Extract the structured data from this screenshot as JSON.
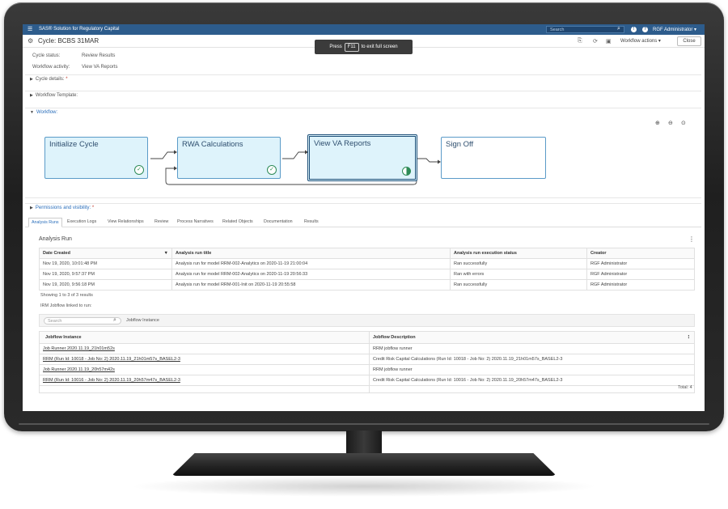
{
  "app": {
    "title": "SAS® Solution for Regulatory Capital",
    "search_placeholder": "Search",
    "user": "RGF Administrator ▾"
  },
  "header": {
    "cycle_title": "Cycle: BCBS 31MAR",
    "workflow_actions": "Workflow actions ▾",
    "close": "Close"
  },
  "toast": {
    "press": "Press",
    "key": "F11",
    "rest": "to exit full screen"
  },
  "info": {
    "cycle_status_label": "Cycle status:",
    "cycle_status_value": "Review Results",
    "workflow_activity_label": "Workflow activity:",
    "workflow_activity_value": "View VA Reports"
  },
  "sections": {
    "cycle_details": "Cycle details:",
    "workflow_template": "Workflow Template:",
    "workflow": "Workflow:",
    "permissions": "Permissions and visibility:",
    "required_mark": "*"
  },
  "workflow_nodes": [
    {
      "label": "Initialize Cycle",
      "status": "complete"
    },
    {
      "label": "RWA Calculations",
      "status": "complete"
    },
    {
      "label": "View VA Reports",
      "status": "in-progress"
    },
    {
      "label": "Sign Off",
      "status": "not-started"
    }
  ],
  "tabs": [
    "Analysis Runs",
    "Execution Logs",
    "View Relationships",
    "Review",
    "Process Narratives",
    "Related Objects",
    "Documentation",
    "Results"
  ],
  "analysis": {
    "panel_title": "Analysis Run",
    "columns": [
      "Date Created",
      "Analysis run title",
      "Analysis run execution status",
      "Creator"
    ],
    "rows": [
      [
        "Nov 19, 2020, 10:01:48 PM",
        "Analysis run for model RRM-002-Analytics on 2020-11-19 21:00:04",
        "Ran successfully",
        "RGF Administrator"
      ],
      [
        "Nov 19, 2020, 9:57:37 PM",
        "Analysis run for model RRM-002-Analytics on 2020-11-19 20:56:33",
        "Ran with errors",
        "RGF Administrator"
      ],
      [
        "Nov 19, 2020, 9:56:18 PM",
        "Analysis run for model RRM-001-Init on 2020-11-19 20:55:58",
        "Ran successfully",
        "RGF Administrator"
      ]
    ],
    "showing": "Showing 1 to 3 of 3 results",
    "linked": "IRM Jobflow linked to run:"
  },
  "jobflow": {
    "search_placeholder": "Search",
    "label": "Jobflow Instance",
    "columns": [
      "Jobflow Instance",
      "Jobflow Description"
    ],
    "rows": [
      [
        "Job Runner 2020.11.19_21h01m52s",
        "RRM jobflow runner"
      ],
      [
        "RRM (Run Id: 10018 - Job No: 2) 2020.11.19_21h01m57s_BASEL2-3",
        "Credit Risk Capital Calculations (Run Id: 10018 - Job No: 2) 2020.11.19_21h01m57s_BASEL2-3"
      ],
      [
        "Job Runner 2020.11.19_20h57m42s",
        "RRM jobflow runner"
      ],
      [
        "RRM (Run Id: 10016 - Job No: 2) 2020.11.19_20h57m47s_BASEL2-3",
        "Credit Risk Capital Calculations (Run Id: 10016 - Job No: 2) 2020.11.19_20h57m47s_BASEL2-3"
      ]
    ],
    "total": "Total: 4"
  },
  "colors": {
    "topbar": "#2d5c8c",
    "node_fill": "#def3fb",
    "node_border": "#5b9bc8",
    "link_blue": "#2a6ebb"
  }
}
